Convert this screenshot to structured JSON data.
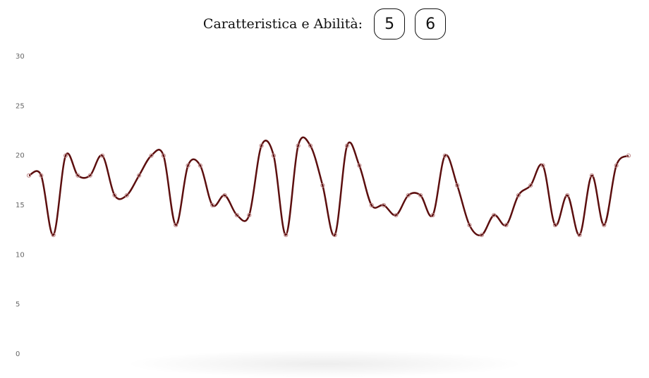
{
  "header": {
    "title": "Caratteristica e Abilità:",
    "scores": [
      "5",
      "6"
    ]
  },
  "chart_data": {
    "type": "line",
    "title": "",
    "xlabel": "",
    "ylabel": "",
    "ylim": [
      0,
      30
    ],
    "yticks": [
      0,
      5,
      10,
      15,
      20,
      25,
      30
    ],
    "grid": false,
    "legend": "none",
    "line_color": "#5c0f0f",
    "marker_color": "#c08a8a",
    "series": [
      {
        "values": [
          18,
          18,
          12,
          20,
          18,
          18,
          20,
          16,
          16,
          18,
          20,
          20,
          13,
          19,
          19,
          15,
          16,
          14,
          14,
          21,
          20,
          12,
          21,
          21,
          17,
          12,
          21,
          19,
          15,
          15,
          14,
          16,
          16,
          14,
          20,
          17,
          13,
          12,
          14,
          13,
          16,
          17,
          19,
          13,
          16,
          12,
          18,
          13,
          19,
          20
        ]
      }
    ]
  }
}
